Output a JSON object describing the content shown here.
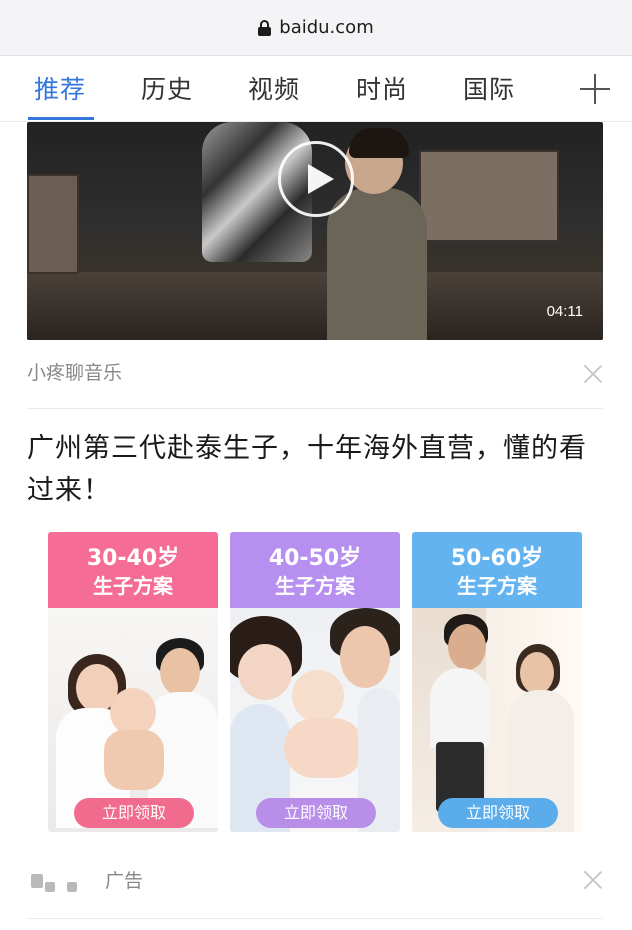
{
  "browser": {
    "domain": "baidu.com"
  },
  "tabs": [
    {
      "label": "推荐",
      "active": true
    },
    {
      "label": "历史",
      "active": false
    },
    {
      "label": "视频",
      "active": false
    },
    {
      "label": "时尚",
      "active": false
    },
    {
      "label": "国际",
      "active": false
    }
  ],
  "video_card": {
    "duration": "04:11",
    "source": "小疼聊音乐"
  },
  "ad": {
    "title": "广州第三代赴泰生子，十年海外直营，懂的看过来！",
    "cards": [
      {
        "age": "30-40岁",
        "plan": "生子方案",
        "button": "立即领取",
        "color": "#f56d96",
        "button_color": "#f06b8e"
      },
      {
        "age": "40-50岁",
        "plan": "生子方案",
        "button": "立即领取",
        "color": "#b68ff0",
        "button_color": "#b98ee9"
      },
      {
        "age": "50-60岁",
        "plan": "生子方案",
        "button": "立即领取",
        "color": "#63b3f0",
        "button_color": "#5aaceb"
      }
    ],
    "footer_label": "广告"
  },
  "icons": {
    "lock": "lock-icon",
    "add": "plus-icon",
    "play": "play-icon",
    "close": "close-icon"
  },
  "colors": {
    "accent": "#3377dd"
  }
}
